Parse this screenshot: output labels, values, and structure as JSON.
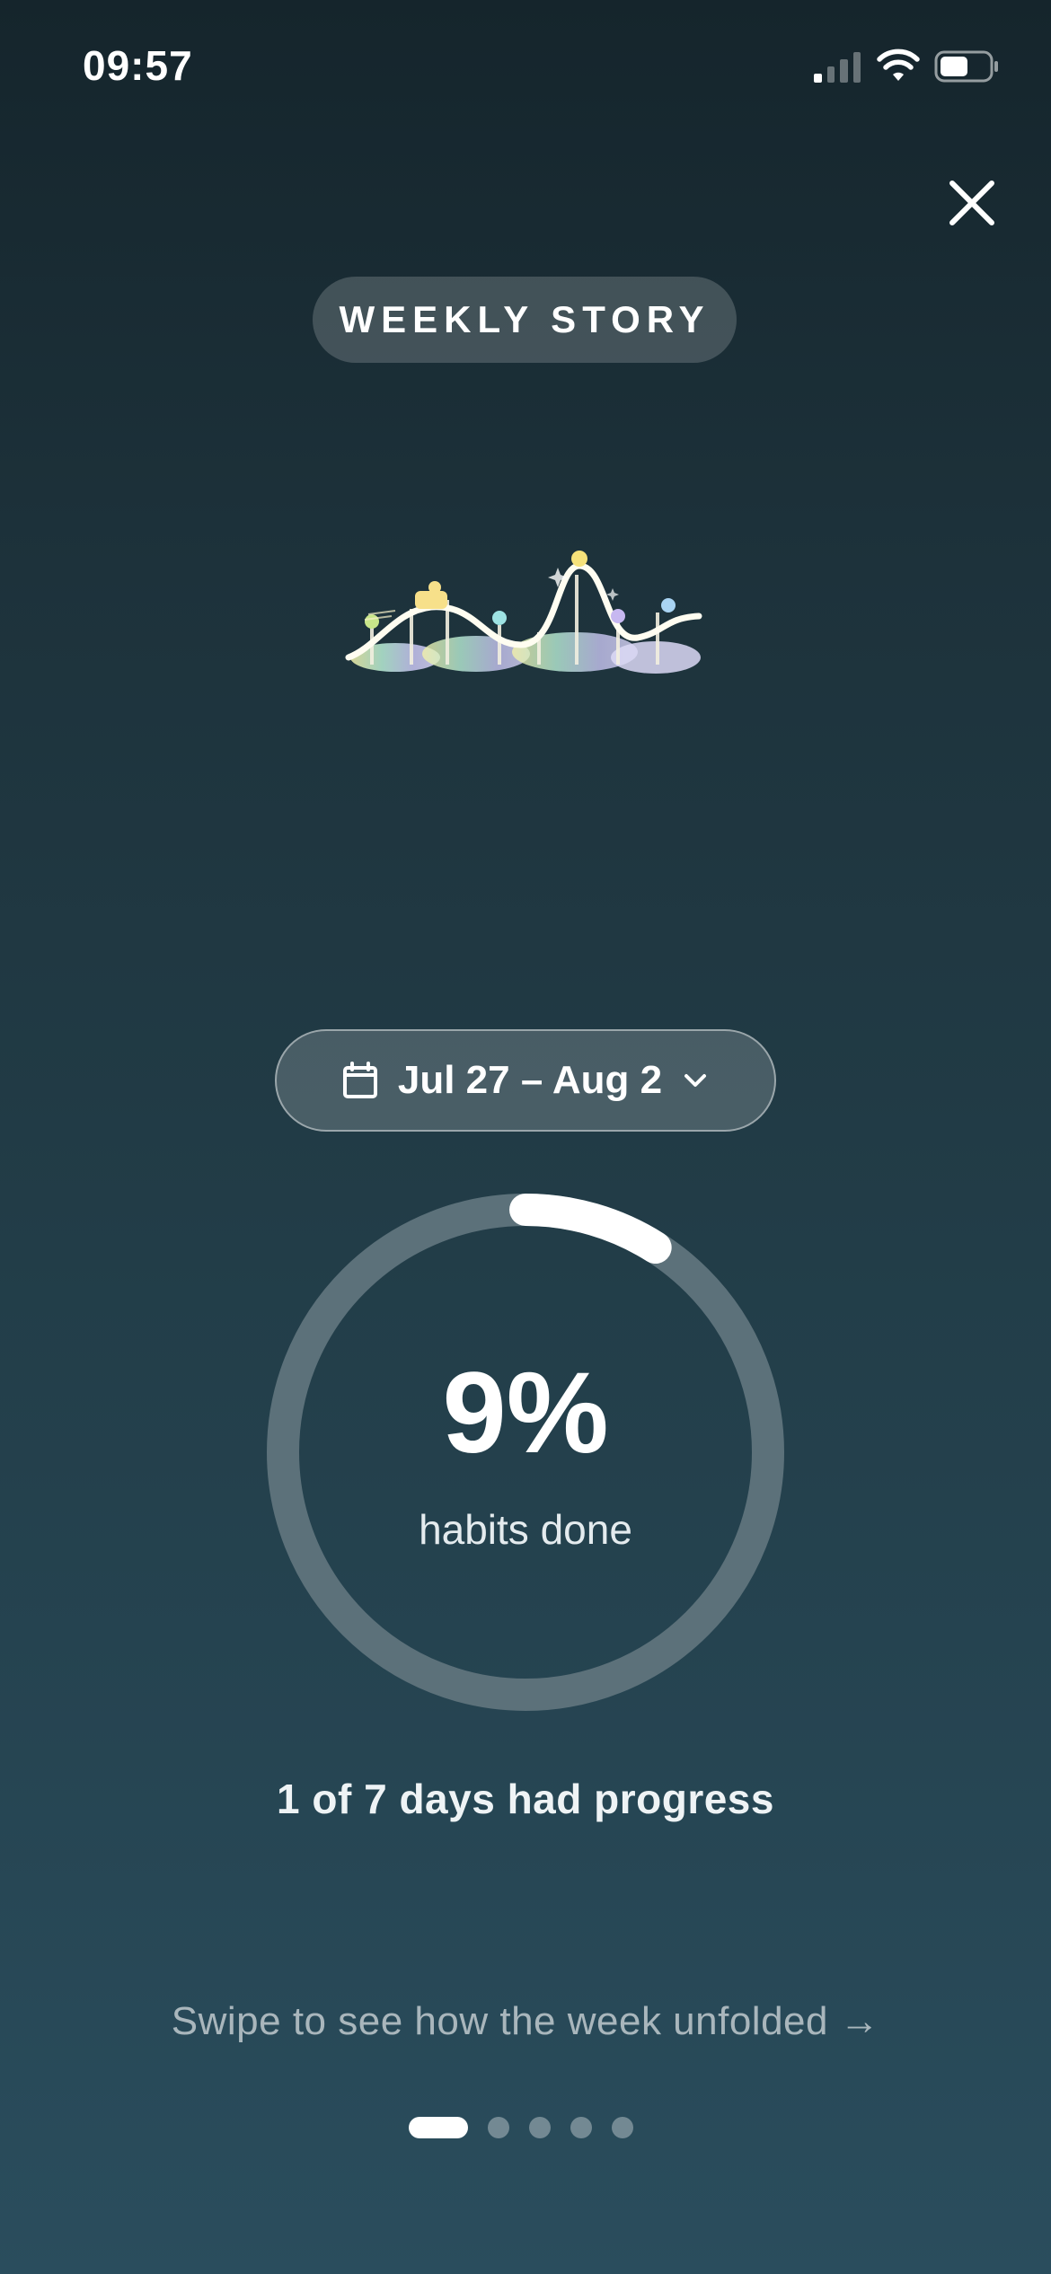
{
  "status_bar": {
    "time": "09:57",
    "signal_icon": "cellular-signal-icon",
    "wifi_icon": "wifi-icon",
    "battery_icon": "battery-icon",
    "battery_level": 0.5
  },
  "close_icon": "close-icon",
  "header": {
    "pill_label": "WEEKLY STORY"
  },
  "illustration": "roller-coaster-illustration",
  "date_selector": {
    "calendar_icon": "calendar-icon",
    "label": "Jul 27 – Aug 2",
    "chevron_icon": "chevron-down-icon"
  },
  "progress": {
    "percent_label": "9%",
    "value": 0.09,
    "caption": "habits done"
  },
  "summary": "1 of 7 days had progress",
  "hint": "Swipe to see how the week unfolded →",
  "pagination": {
    "count": 5,
    "active_index": 0
  },
  "colors": {
    "background_top": "#15252c",
    "background_bottom": "#2a4d5d",
    "ring_track": "#5c717a",
    "ring_fill": "#ffffff"
  }
}
